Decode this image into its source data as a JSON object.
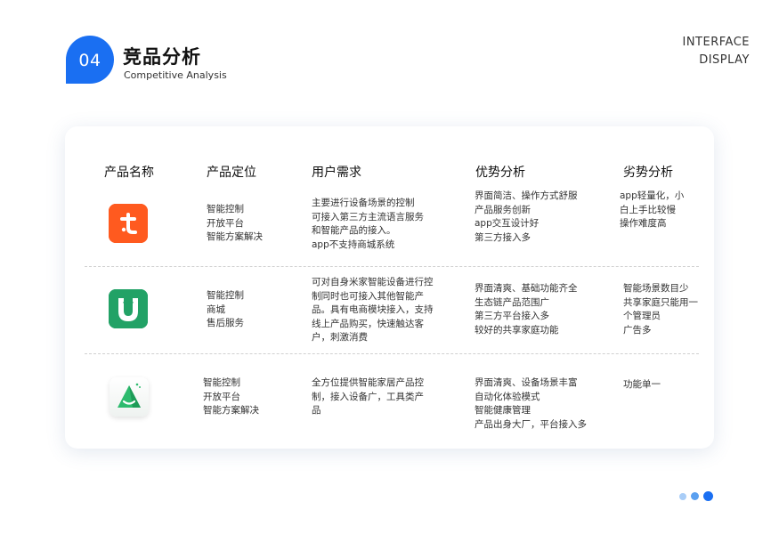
{
  "header": {
    "badge_number": "04",
    "title": "竞品分析",
    "subtitle": "Competitive Analysis",
    "corner_line1": "INTERFACE",
    "corner_line2": "DISPLAY"
  },
  "table": {
    "columns": [
      "产品名称",
      "产品定位",
      "用户需求",
      "优势分析",
      "劣势分析"
    ],
    "rows": [
      {
        "icon": "tuya-app-icon",
        "positioning": "智能控制\n开放平台\n智能方案解决",
        "user_needs": "主要进行设备场景的控制\n可接入第三方主流语言服务\n和智能产品的接入。\napp不支持商城系统",
        "advantages": "界面简洁、操作方式舒服\n产品服务创新\napp交互设计好\n第三方接入多",
        "disadvantages": "app轻量化，小\n白上手比较慢\n操作难度高"
      },
      {
        "icon": "mijia-app-icon",
        "positioning": "智能控制\n商城\n售后服务",
        "user_needs": "可对自身米家智能设备进行控\n制同时也可接入其他智能产\n品。具有电商模块接入，支持\n线上产品购买，快速触达客\n户，刺激消费",
        "advantages": "界面清爽、基础功能齐全\n生态链产品范围广\n第三方平台接入多\n较好的共享家庭功能",
        "disadvantages": "智能场景数目少\n共享家庭只能用一\n个管理员\n广告多"
      },
      {
        "icon": "smart-home-app-icon",
        "positioning": "智能控制\n开放平台\n智能方案解决",
        "user_needs": "全方位提供智能家居产品控\n制，接入设备广，工具类产\n品",
        "advantages": "界面清爽、设备场景丰富\n自动化体验模式\n智能健康管理\n产品出身大厂，平台接入多",
        "disadvantages": "功能单一"
      }
    ]
  },
  "colors": {
    "accent": "#1a6ff2",
    "tuya": "#ff5a1f",
    "mijia": "#22a266",
    "dot_light": "#a9cdf7",
    "dot_mid": "#5aa0f0",
    "dot_active": "#1a6ff2"
  }
}
